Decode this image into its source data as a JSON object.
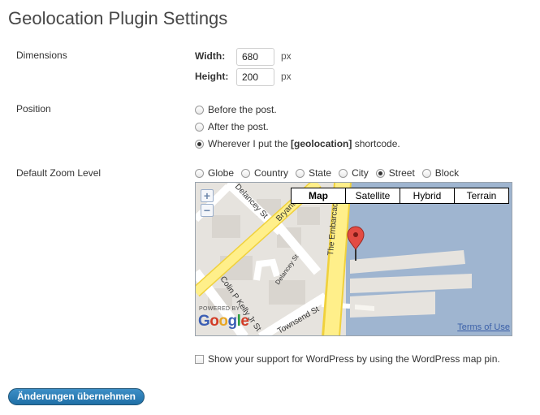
{
  "page": {
    "title": "Geolocation Plugin Settings"
  },
  "dimensions": {
    "label": "Dimensions",
    "width_label": "Width:",
    "width_value": "680",
    "height_label": "Height:",
    "height_value": "200",
    "unit": "px"
  },
  "position": {
    "label": "Position",
    "options": [
      {
        "label": "Before the post.",
        "checked": false
      },
      {
        "label": "After the post.",
        "checked": false
      },
      {
        "label_before": "Wherever I put the ",
        "label_bold": "[geolocation]",
        "label_after": " shortcode.",
        "checked": true
      }
    ]
  },
  "zoom": {
    "label": "Default Zoom Level",
    "options": [
      {
        "label": "Globe",
        "checked": false
      },
      {
        "label": "Country",
        "checked": false
      },
      {
        "label": "State",
        "checked": false
      },
      {
        "label": "City",
        "checked": false
      },
      {
        "label": "Street",
        "checked": true
      },
      {
        "label": "Block",
        "checked": false
      }
    ]
  },
  "map": {
    "types": [
      "Map",
      "Satellite",
      "Hybrid",
      "Terrain"
    ],
    "selected_type": "Map",
    "zoom_in": "+",
    "zoom_out": "−",
    "powered_by": "POWERED BY",
    "logo": [
      "G",
      "o",
      "o",
      "g",
      "l",
      "e"
    ],
    "terms": "Terms of Use",
    "streets": [
      "Delancey St",
      "Bryant St",
      "The Embarcadero",
      "Delancey St",
      "Colin P Kelly Jr St",
      "Townsend St"
    ],
    "colors": {
      "water": "#9fb5d0",
      "land": "#e6e3de",
      "road": "#ffef8a",
      "marker": "#e34b43"
    }
  },
  "support": {
    "label": "Show your support for WordPress by using the WordPress map pin.",
    "checked": false
  },
  "submit": {
    "label": "Änderungen übernehmen"
  }
}
